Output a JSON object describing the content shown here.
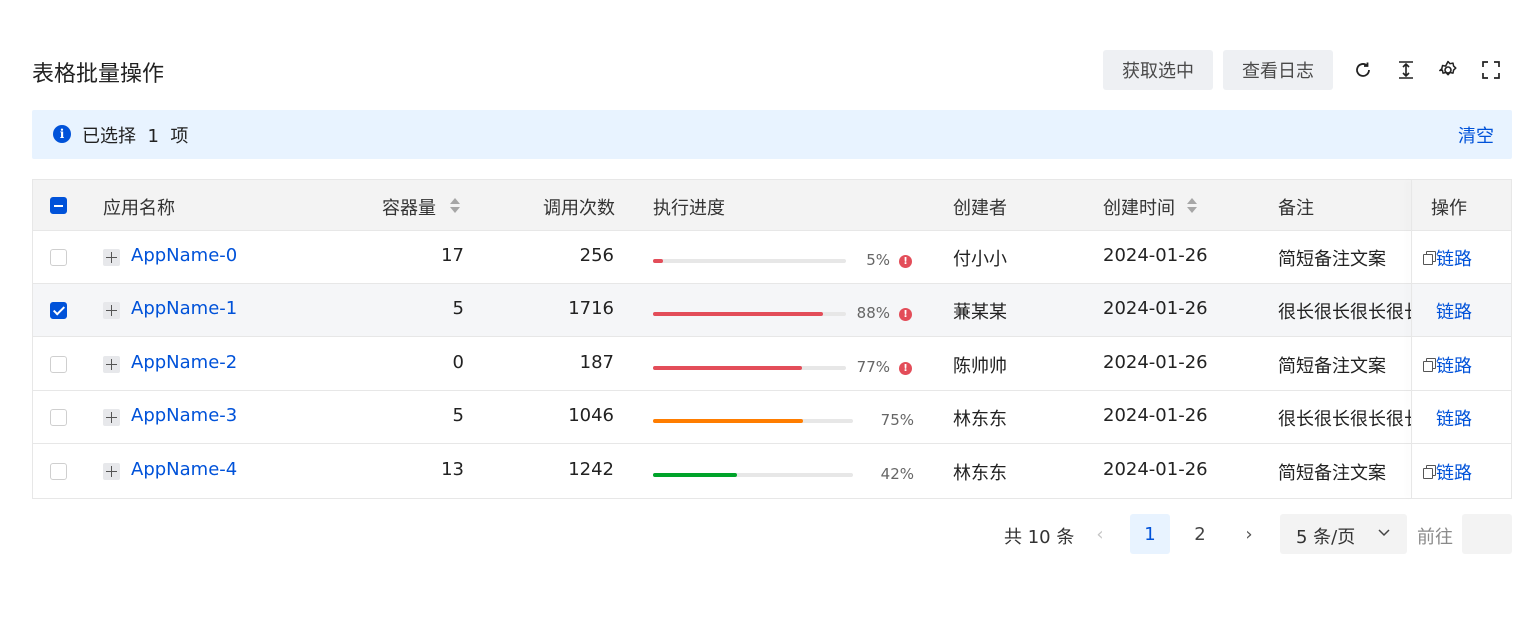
{
  "header": {
    "title": "表格批量操作",
    "get_selected_label": "获取选中",
    "view_log_label": "查看日志",
    "tool_icons": [
      "refresh-icon",
      "column-height-icon",
      "settings-icon",
      "fullscreen-icon"
    ]
  },
  "alert": {
    "text": "已选择  1  项",
    "clear_label": "清空"
  },
  "table": {
    "columns": {
      "name": "应用名称",
      "capacity": "容器量",
      "calls": "调用次数",
      "progress": "执行进度",
      "creator": "创建者",
      "created_time": "创建时间",
      "remark": "备注",
      "action": "操作"
    },
    "rows": [
      {
        "checked": false,
        "name": "AppName-0",
        "capacity": "17",
        "calls": "256",
        "progress_value": 5,
        "progress_label": "5%",
        "progress_status": "error",
        "creator": "付小小",
        "created_time": "2024-01-26",
        "remark": "简短备注文案",
        "remark_type": "short",
        "action": "链路"
      },
      {
        "checked": true,
        "name": "AppName-1",
        "capacity": "5",
        "calls": "1716",
        "progress_value": 88,
        "progress_label": "88%",
        "progress_status": "error",
        "creator": "蒹某某",
        "created_time": "2024-01-26",
        "remark": "很长很长很长很长很长很长很长很长很长很长",
        "remark_type": "long",
        "action": "链路"
      },
      {
        "checked": false,
        "name": "AppName-2",
        "capacity": "0",
        "calls": "187",
        "progress_value": 77,
        "progress_label": "77%",
        "progress_status": "error",
        "creator": "陈帅帅",
        "created_time": "2024-01-26",
        "remark": "简短备注文案",
        "remark_type": "short",
        "action": "链路"
      },
      {
        "checked": false,
        "name": "AppName-3",
        "capacity": "5",
        "calls": "1046",
        "progress_value": 75,
        "progress_label": "75%",
        "progress_status": "warning",
        "creator": "林东东",
        "created_time": "2024-01-26",
        "remark": "很长很长很长很长很长很长很长很长很长很长",
        "remark_type": "long",
        "action": "链路"
      },
      {
        "checked": false,
        "name": "AppName-4",
        "capacity": "13",
        "calls": "1242",
        "progress_value": 42,
        "progress_label": "42%",
        "progress_status": "success",
        "creator": "林东东",
        "created_time": "2024-01-26",
        "remark": "简短备注文案",
        "remark_type": "short",
        "action": "链路"
      }
    ]
  },
  "colors": {
    "brand": "#0052d9",
    "error": "#e34d59",
    "warning": "#ed7b0f",
    "success": "#00a870",
    "error_bar": "#e34d59",
    "warning_bar": "#ff7d00",
    "success_bar": "#00a32a"
  },
  "pagination": {
    "total_label": "共 10 条",
    "pages": [
      "1",
      "2"
    ],
    "current_page": "1",
    "page_size_label": "5 条/页",
    "goto_label": "前往"
  }
}
